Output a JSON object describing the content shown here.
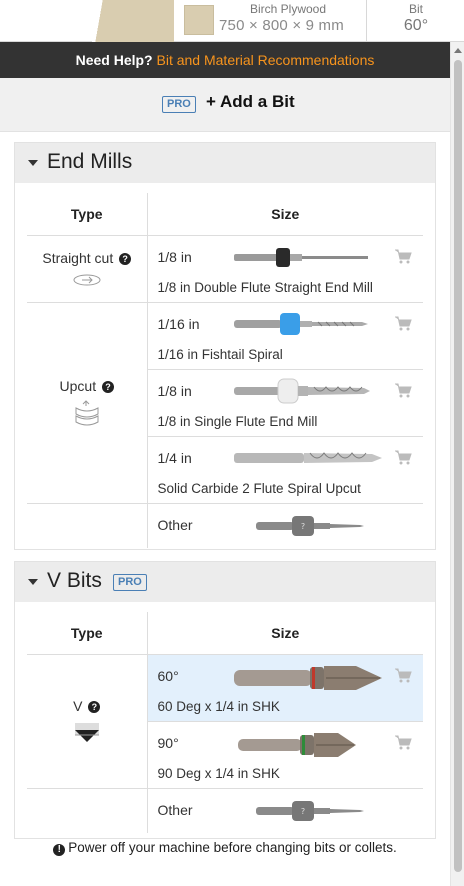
{
  "material": {
    "name": "Birch Plywood",
    "dims": "750 × 800 × 9 mm",
    "swatch_color": "#d9cdb0"
  },
  "bit_status": {
    "label": "Bit",
    "value": "60°"
  },
  "help": {
    "prefix": "Need Help?",
    "link": "Bit and Material Recommendations"
  },
  "add_bit": {
    "badge": "PRO",
    "label": "+ Add a Bit"
  },
  "end_mills": {
    "title": "End Mills",
    "headers": {
      "type": "Type",
      "size": "Size"
    },
    "straight": {
      "type": "Straight cut",
      "bits": [
        {
          "size": "1/8 in",
          "desc": "1/8 in Double Flute Straight End Mill",
          "collar": "#2a2a2a"
        }
      ]
    },
    "upcut": {
      "type": "Upcut",
      "bits": [
        {
          "size": "1/16 in",
          "desc": "1/16 in Fishtail Spiral",
          "collar": "#3a9ee8"
        },
        {
          "size": "1/8 in",
          "desc": "1/8 in Single Flute End Mill",
          "collar": "#f0f0f0"
        },
        {
          "size": "1/4 in",
          "desc": "Solid Carbide 2 Flute Spiral Upcut",
          "collar": "none"
        }
      ]
    },
    "other": "Other"
  },
  "v_bits": {
    "title": "V Bits",
    "badge": "PRO",
    "headers": {
      "type": "Type",
      "size": "Size"
    },
    "v": {
      "type": "V",
      "bits": [
        {
          "size": "60°",
          "desc": "60 Deg x 1/4 in SHK",
          "selected": true,
          "ring": "#c0392b"
        },
        {
          "size": "90°",
          "desc": "90 Deg x 1/4 in SHK",
          "selected": false,
          "ring": "#2e8b3a"
        }
      ]
    },
    "other": "Other"
  },
  "warning": "Power off your machine before changing bits or collets."
}
